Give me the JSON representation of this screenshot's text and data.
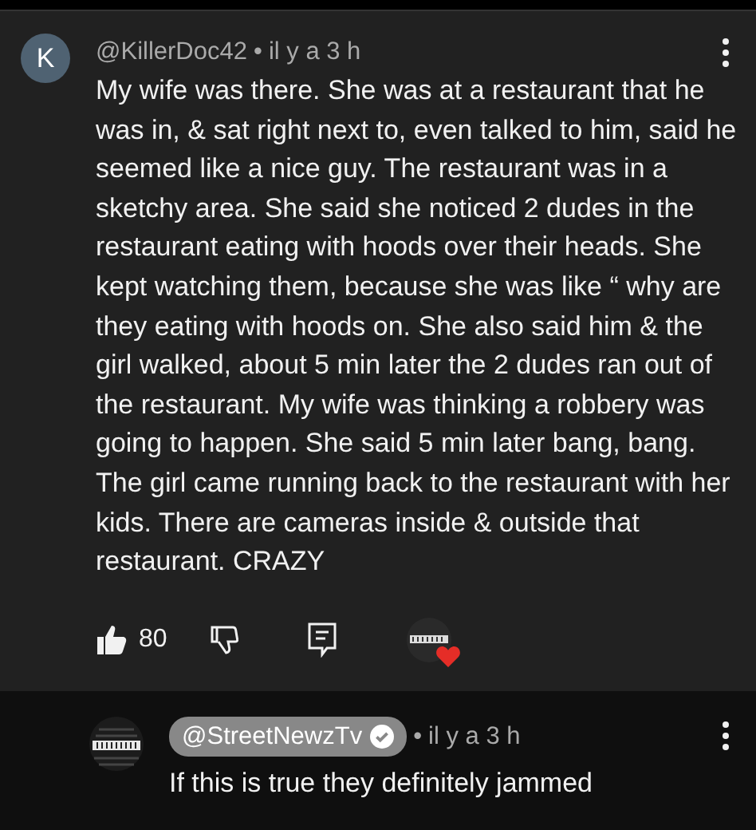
{
  "comment": {
    "avatar_letter": "K",
    "handle": "@KillerDoc42",
    "separator": "•",
    "time": "il y a 3 h",
    "text": "My wife was there. She was at a restaurant that he was in, & sat right next to, even talked to him, said he seemed like a nice guy. The restaurant was in a sketchy area. She said she noticed 2 dudes in the restaurant eating with hoods over their heads. She kept watching them, because she was like “ why are they eating with hoods on. She also said him & the girl walked, about 5 min later the 2 dudes ran out of the restaurant. My wife was thinking a robbery was going to happen. She said 5 min later bang, bang. The girl came running back to the restaurant with her kids. There are cameras inside & outside that restaurant. CRAZY",
    "likes": "80",
    "creator_hearted": true
  },
  "reply": {
    "handle": "@StreetNewzTv",
    "verified": true,
    "separator": "•",
    "time": "il y a 3 h",
    "text": "If this is true they definitely jammed"
  }
}
